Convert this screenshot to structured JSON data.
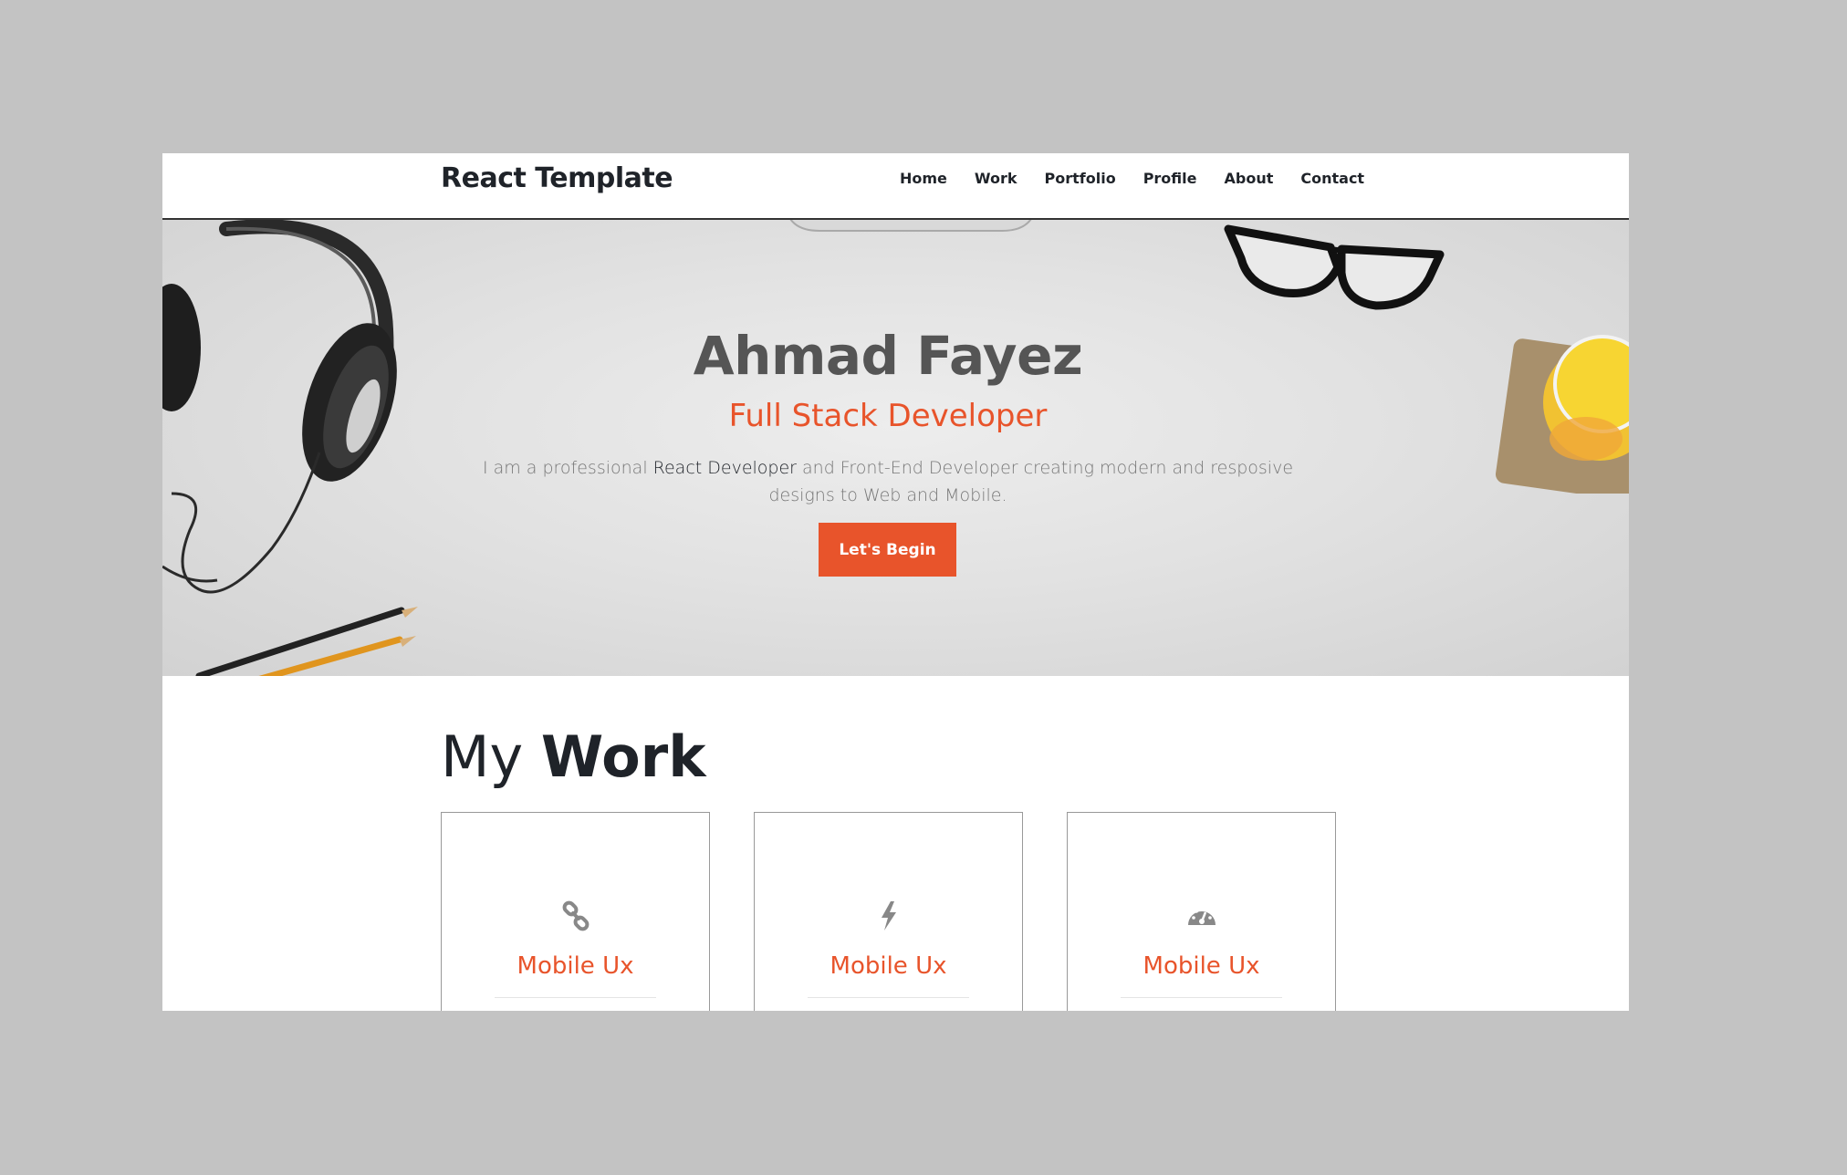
{
  "navbar": {
    "brand": "React Template",
    "links": [
      "Home",
      "Work",
      "Portfolio",
      "Profile",
      "About",
      "Contact"
    ]
  },
  "hero": {
    "name": "Ahmad Fayez",
    "role": "Full Stack Developer",
    "desc_before": "I am a professional ",
    "desc_highlight": "React Developer",
    "desc_after": " and Front-End Developer creating modern and resposive designs to Web and Mobile.",
    "button": "Let's Begin"
  },
  "work": {
    "title_light": "My ",
    "title_bold": "Work",
    "cards": [
      {
        "icon": "link-icon",
        "title": "Mobile Ux"
      },
      {
        "icon": "bolt-icon",
        "title": "Mobile Ux"
      },
      {
        "icon": "dashboard-icon",
        "title": "Mobile Ux"
      }
    ]
  },
  "colors": {
    "accent": "#e8542b",
    "text_dark": "#1f2329",
    "hero_name": "#555555",
    "background": "#c3c3c3"
  }
}
